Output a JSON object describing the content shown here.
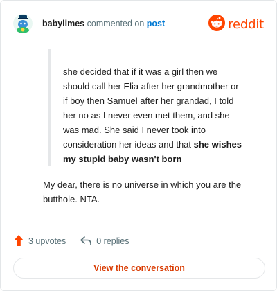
{
  "header": {
    "username": "babylimes",
    "action_text": " commented on ",
    "post_link": "post",
    "brand_wordmark": "reddit"
  },
  "quote": {
    "text": "she decided that if it was a girl then we should call her Elia after her grandmother or if boy then Samuel after her grandad, I told her no as I never even met them, and she was mad. She said I never took into consideration her ideas and that ",
    "bold_text": "she wishes my stupid baby wasn't born"
  },
  "comment": {
    "body": "My dear, there is no universe in which you are the butthole. NTA."
  },
  "actions": {
    "upvotes_label": "3 upvotes",
    "replies_label": "0 replies"
  },
  "cta": {
    "label": "View the conversation"
  },
  "colors": {
    "brand": "#ff4500",
    "link": "#0079d3",
    "cta_text": "#d93a00",
    "muted": "#576f76"
  },
  "icons": {
    "avatar": "avatar-snoo",
    "brand": "reddit-logo-icon",
    "upvote": "upvote-arrow-icon",
    "reply": "reply-arrow-icon"
  }
}
